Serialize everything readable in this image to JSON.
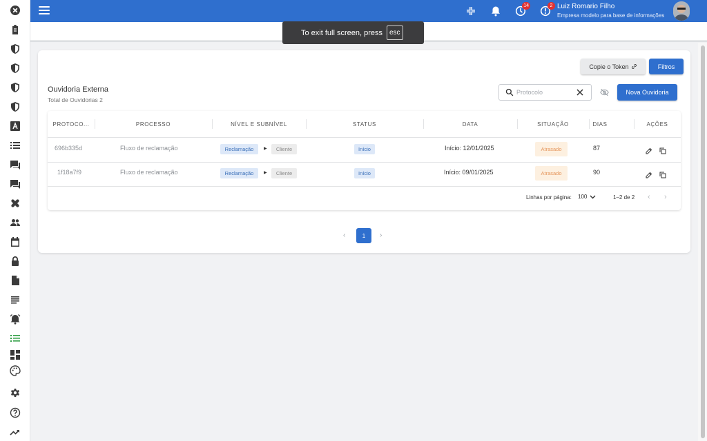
{
  "topbar": {
    "user_name": "Luiz Romario Filho",
    "company": "Empresa modelo para base de informações",
    "badge_timer": "14",
    "badge_alerts": "2",
    "accent": "#2f6fce"
  },
  "toast": {
    "text": "To exit full screen, press",
    "key": "esc"
  },
  "card": {
    "title": "Ouvidoria Externa",
    "subtitle": "Total de Ouvidorias 2",
    "copy_token_label": "Copie o Token",
    "filters_label": "Filtros",
    "new_button_label": "Nova Ouvidoria",
    "search": {
      "placeholder": "Protocolo",
      "value": ""
    }
  },
  "table": {
    "headers": [
      "PROTOCO...",
      "PROCESSO",
      "NÍVEL E SUBNÍVEL",
      "STATUS",
      "DATA",
      "SITUAÇÃO",
      "DIAS",
      "AÇÕES"
    ],
    "rows": [
      {
        "protocol": "696b335d",
        "process": "Fluxo de reclamação",
        "level": "Reclamação",
        "sublevel": "Cliente",
        "status": "Início",
        "date": "Início: 12/01/2025",
        "situation": "Atrasado",
        "days": "87"
      },
      {
        "protocol": "1f18a7f9",
        "process": "Fluxo de reclamação",
        "level": "Reclamação",
        "sublevel": "Cliente",
        "status": "Início",
        "date": "Início: 09/01/2025",
        "situation": "Atrasado",
        "days": "90"
      }
    ],
    "footer": {
      "rows_per_page_label": "Linhas por página:",
      "rows_per_page_value": "100",
      "range": "1–2 de 2"
    }
  },
  "pagination": {
    "current_page": "1"
  },
  "sidebar": {
    "icons": [
      "close-icon",
      "clipboard-icon",
      "shield-icon",
      "shield-icon",
      "shield-icon",
      "shield-icon",
      "font-icon",
      "list-icon",
      "chat-icon",
      "chat-icon",
      "healing-icon",
      "people-icon",
      "calendar-icon",
      "lock-icon",
      "document-icon",
      "notes-icon",
      "alarm-icon",
      "checklist-icon",
      "dashboard-icon",
      "palette-icon",
      "settings-icon",
      "help-icon",
      "trending-icon"
    ]
  }
}
